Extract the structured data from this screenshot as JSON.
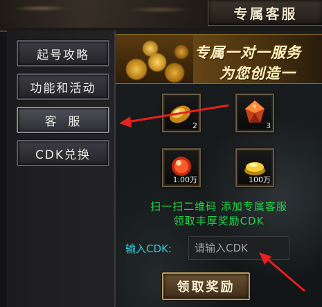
{
  "header": {
    "title": "专属客服"
  },
  "sidebar": {
    "tabs": [
      {
        "label": "起号攻略"
      },
      {
        "label": "功能和活动"
      },
      {
        "label": "客  服"
      },
      {
        "label": "CDK兑换"
      }
    ],
    "active_index": 2
  },
  "banner": {
    "line1": "专属一对一服务",
    "line2": "为您创造一"
  },
  "rewards": [
    {
      "icon": "gold-ingot-icon",
      "count": "2"
    },
    {
      "icon": "red-gem-icon",
      "count": "3"
    },
    {
      "icon": "red-orb-icon",
      "count": "1.00万"
    },
    {
      "icon": "gold-bars-icon",
      "count": "100万"
    }
  ],
  "info": {
    "line1": "扫一扫二维码  添加专属客服",
    "line2": "领取丰厚奖励CDK"
  },
  "cdk": {
    "label": "输入CDK:",
    "placeholder": "请输入CDK"
  },
  "claim_button": "领取奖励",
  "colors": {
    "info_green": "#1fd84a",
    "label_cyan": "#2fd0d8",
    "annotation_red": "#e82020"
  }
}
